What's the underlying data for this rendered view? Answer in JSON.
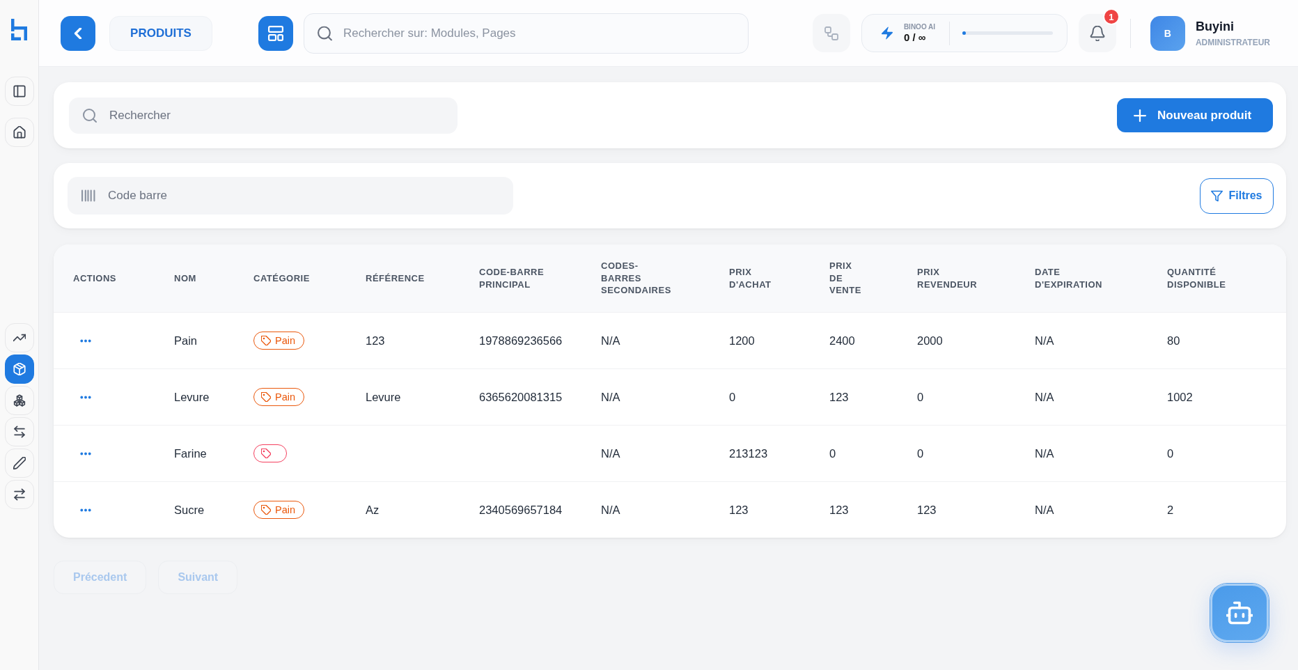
{
  "sidebar": {
    "top_items": [
      {
        "selected": false
      },
      {
        "selected": false
      }
    ],
    "bottom_items": [
      {
        "selected": false
      },
      {
        "selected": true
      },
      {
        "selected": false
      },
      {
        "selected": false
      },
      {
        "selected": false
      },
      {
        "selected": false
      }
    ]
  },
  "header": {
    "page_title": "PRODUITS",
    "search": {
      "placeholder": "Rechercher sur: Modules, Pages"
    },
    "ai_usage": {
      "label": "BINOO AI",
      "usage": "0 / ∞",
      "level": 0.04
    },
    "notifications": {
      "count": "1"
    },
    "user": {
      "initial": "B",
      "name": "Buyini",
      "role": "ADMINISTRATEUR"
    }
  },
  "toolbar": {
    "search": {
      "placeholder": "Rechercher"
    },
    "new_button": "Nouveau produit"
  },
  "filter_bar": {
    "barcode_field": {
      "placeholder": "Code barre"
    },
    "filters_button": "Filtres"
  },
  "table": {
    "columns": [
      "ACTIONS",
      "NOM",
      "CATÉGORIE",
      "RÉFÉRENCE",
      "CODE-BARRE PRINCIPAL",
      "CODES-BARRES SECONDAIRES",
      "PRIX D'ACHAT",
      "PRIX DE VENTE",
      "PRIX REVENDEUR",
      "DATE D'EXPIRATION",
      "QUANTITÉ DISPONIBLE"
    ],
    "rows": [
      {
        "name": "Pain",
        "category": {
          "label": "Pain",
          "color": "#ea580c"
        },
        "reference": "123",
        "primary_barcode": "1978869236566",
        "secondary_barcodes": "N/A",
        "purchase_price": "1200",
        "sale_price": "2400",
        "reseller_price": "2000",
        "expiry_date": "N/A",
        "quantity": "80"
      },
      {
        "name": "Levure",
        "category": {
          "label": "Pain",
          "color": "#ea580c"
        },
        "reference": "Levure",
        "primary_barcode": "6365620081315",
        "secondary_barcodes": "N/A",
        "purchase_price": "0",
        "sale_price": "123",
        "reseller_price": "0",
        "expiry_date": "N/A",
        "quantity": "1002"
      },
      {
        "name": "Farine",
        "category": {
          "color": "#f43f5e"
        },
        "secondary_barcodes": "N/A",
        "purchase_price": "213123",
        "sale_price": "0",
        "reseller_price": "0",
        "expiry_date": "N/A",
        "quantity": "0"
      },
      {
        "name": "Sucre",
        "category": {
          "label": "Pain",
          "color": "#ea580c"
        },
        "reference": "Az",
        "primary_barcode": "2340569657184",
        "secondary_barcodes": "N/A",
        "purchase_price": "123",
        "sale_price": "123",
        "reseller_price": "123",
        "expiry_date": "N/A",
        "quantity": "2"
      }
    ]
  },
  "pagination": {
    "previous": {
      "label": "Précedent",
      "disabled": true
    },
    "next": {
      "label": "Suivant",
      "disabled": true
    }
  }
}
